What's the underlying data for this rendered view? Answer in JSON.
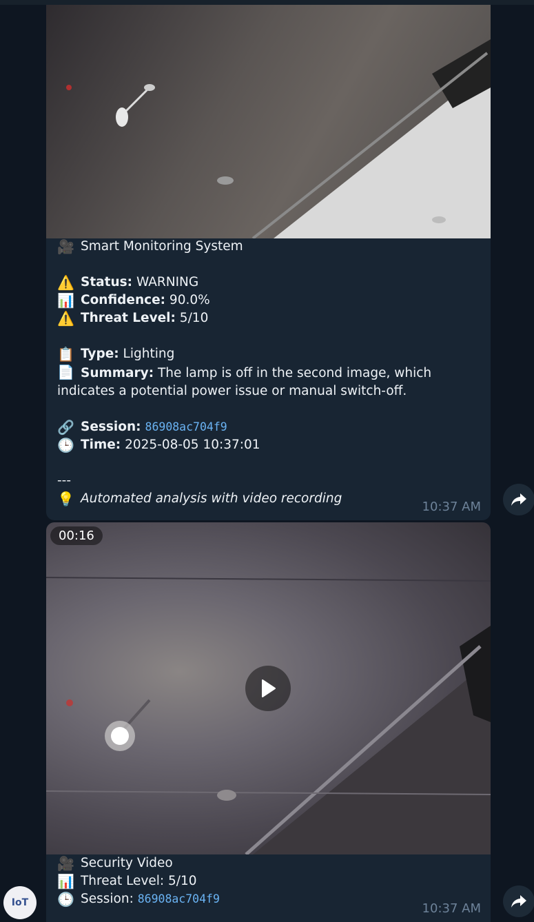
{
  "message1": {
    "title_icon": "video-camera-icon",
    "title": "Smart Monitoring System",
    "status_label": "Status:",
    "status_value": " WARNING",
    "confidence_label": "Confidence:",
    "confidence_value": " 90.0%",
    "threat_label": "Threat Level:",
    "threat_value": " 5/10",
    "type_label": "Type:",
    "type_value": " Lighting",
    "summary_label": "Summary:",
    "summary_value": " The lamp is off in the second image, which indicates a potential power issue or manual switch-off.",
    "session_label": "Session:",
    "session_value": "86908ac704f9",
    "time_label": "Time:",
    "time_value": " 2025-08-05 10:37:01",
    "divider": "---",
    "footer": "Automated analysis with video recording",
    "timestamp": "10:37 AM"
  },
  "message2": {
    "duration": "00:16",
    "title": "Security Video",
    "threat_text": "Threat Level: 5/10",
    "session_label": "Session: ",
    "session_value": "86908ac704f9",
    "timestamp": "10:37 AM"
  },
  "avatar": {
    "label": "IoT"
  },
  "colors": {
    "background": "#0e1621",
    "bubble": "#182533",
    "link": "#6ab3f3",
    "timestamp": "#6d8299"
  }
}
